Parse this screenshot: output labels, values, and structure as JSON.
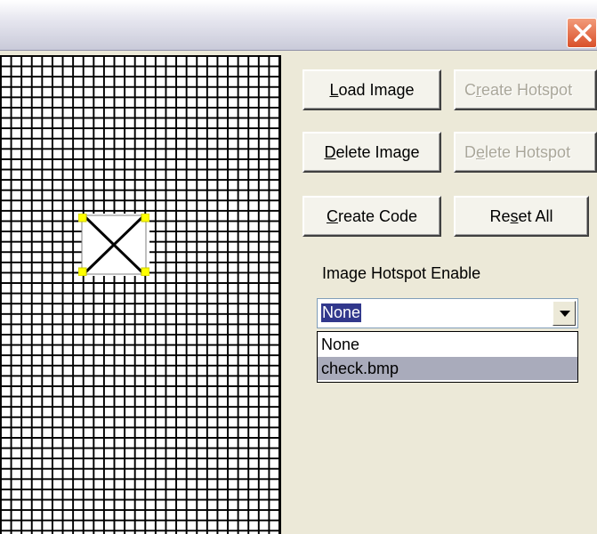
{
  "window": {
    "close_icon": "close-icon",
    "close_color": "#d9502a"
  },
  "buttons": {
    "load_image": {
      "pre": "",
      "key": "L",
      "post": "oad Image"
    },
    "create_hotspot": {
      "pre": "C",
      "key": "r",
      "post": "eate Hotspot"
    },
    "delete_image": {
      "pre": "",
      "key": "D",
      "post": "elete Image"
    },
    "delete_hotspot": {
      "pre": "D",
      "key": "e",
      "post": "lete Hotspot"
    },
    "create_code": {
      "pre": "",
      "key": "C",
      "post": "reate Code"
    },
    "reset_all": {
      "pre": "Re",
      "key": "s",
      "post": "et All"
    }
  },
  "hotspot_enable": {
    "label": "Image Hotspot Enable",
    "selected_value": "None",
    "options": [
      "None",
      "check.bmp"
    ],
    "highlighted_option": "check.bmp"
  },
  "canvas": {
    "hotspot_icon": "x-image-icon",
    "handle_color": "#ffff00"
  }
}
